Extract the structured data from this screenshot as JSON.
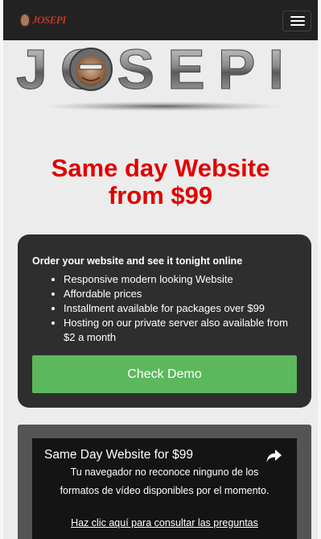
{
  "navbar": {
    "brand_text": "JOSEPI",
    "menu_icon": "hamburger-menu-icon"
  },
  "hero": {
    "logo_text": "JOSEPI"
  },
  "headline": {
    "line1": "Same day Website",
    "line2": "from $99",
    "color": "#e10000"
  },
  "offer_card": {
    "title": "Order your website and see it tonight online",
    "features": [
      "Responsive modern looking Website",
      "Affordable prices",
      "Installment available for packages over $99",
      "Hosting on our private server also available from $2 a month"
    ],
    "button_label": "Check Demo",
    "button_color": "#5cb85c"
  },
  "video": {
    "title": "Same Day Website for $99",
    "share_icon": "share-arrow-icon",
    "message": "Tu navegador no reconoce ninguno de los formatos de vídeo disponibles por el momento.",
    "link_text": "Haz clic aquí para consultar las preguntas"
  }
}
